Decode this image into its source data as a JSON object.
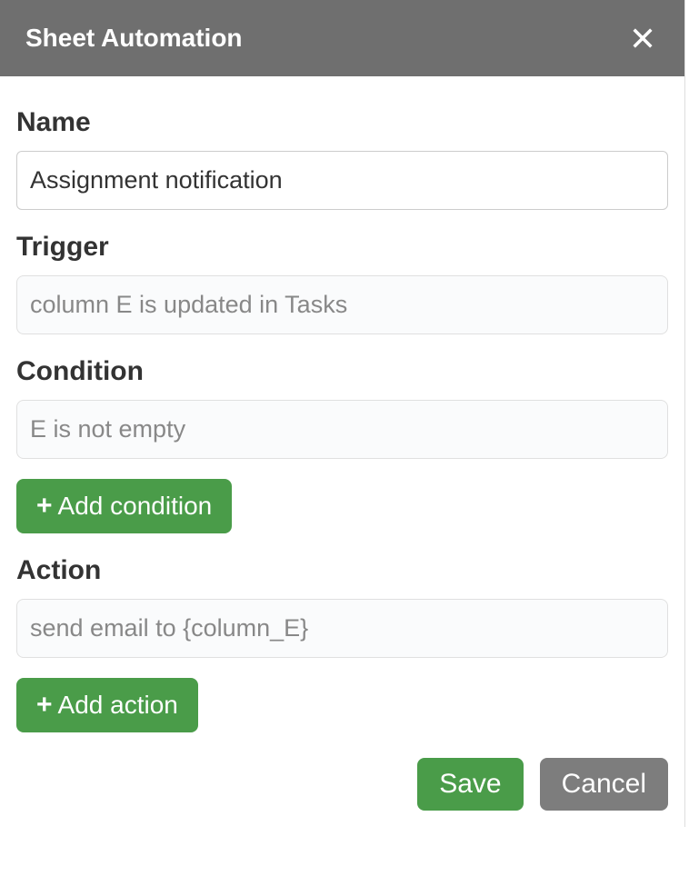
{
  "header": {
    "title": "Sheet Automation"
  },
  "form": {
    "name_label": "Name",
    "name_value": "Assignment notification",
    "trigger_label": "Trigger",
    "trigger_value": "column E is updated in Tasks",
    "condition_label": "Condition",
    "condition_value": "E is not empty",
    "add_condition_label": "Add condition",
    "action_label": "Action",
    "action_value": "send email to {column_E}",
    "add_action_label": "Add action"
  },
  "footer": {
    "save_label": "Save",
    "cancel_label": "Cancel"
  }
}
